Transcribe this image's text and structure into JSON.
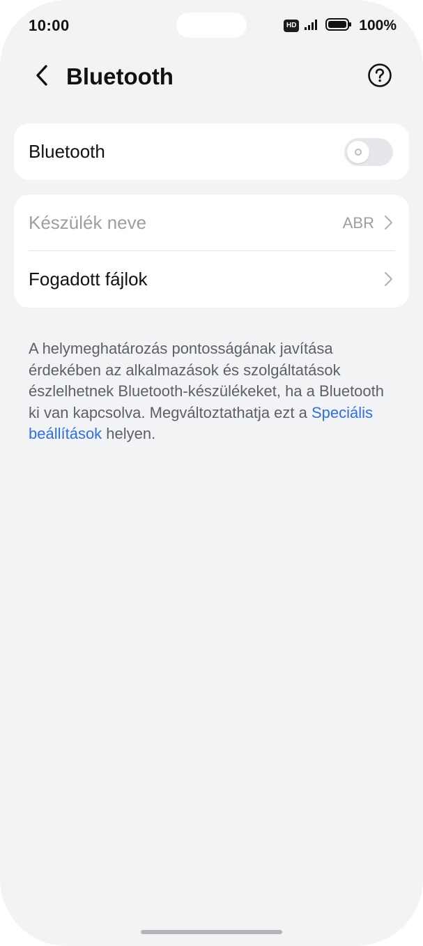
{
  "status_bar": {
    "time": "10:00",
    "network_badge": "HD",
    "battery_percent": "100%",
    "icons": [
      "hd-badge",
      "signal-icon",
      "battery-icon"
    ]
  },
  "header": {
    "title": "Bluetooth",
    "back_icon": "chevron-left-icon",
    "help_icon": "question-circle-icon"
  },
  "bluetooth_card": {
    "label": "Bluetooth",
    "toggle_state": "off"
  },
  "settings_list": {
    "items": [
      {
        "label": "Készülék neve",
        "value": "ABR",
        "enabled": false
      },
      {
        "label": "Fogadott fájlok",
        "value": "",
        "enabled": true
      }
    ]
  },
  "info": {
    "text_before": "A helymeghatározás pontosságának javítása érdekében az alkalmazások és szolgáltatások észlelhetnek Bluetooth-készülékeket, ha a Bluetooth ki van kapcsolva. Megváltoztathatja ezt a ",
    "link_text": "Speciális beállítások",
    "text_after": " helyen."
  },
  "colors": {
    "background": "#f2f3f5",
    "card": "#ffffff",
    "link": "#2f6fe0",
    "muted_text": "#9b9ea3"
  }
}
